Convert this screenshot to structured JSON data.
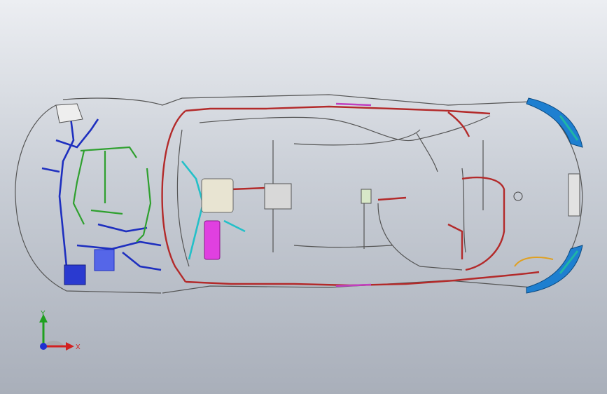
{
  "viewport": {
    "background_top": "#eceef2",
    "background_bottom": "#a9afba"
  },
  "model": {
    "description_icon": "car-wiring-harness-icon",
    "colors": {
      "main_trunk": "#b32a2a",
      "body_line": "#444444",
      "engine_harness": "#1e2fbf",
      "engine_sub": "#2fa02f",
      "instrument": "#23c0c8",
      "ecu": "#e040e0",
      "rear_lamp": "#1e7fd0",
      "rear_lamp_accent": "#1fb5a5",
      "yellow_lead": "#e0a020"
    }
  },
  "triad": {
    "x_label": "X",
    "y_label": "Y",
    "x_color": "#d22020",
    "y_color": "#1fa01f",
    "z_color": "#2030d0"
  }
}
